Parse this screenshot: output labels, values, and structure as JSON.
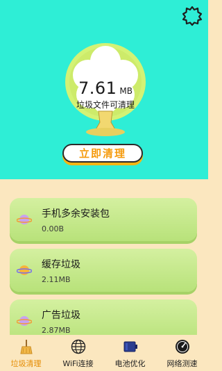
{
  "scan": {
    "size_value": "7.61",
    "size_unit": "MB",
    "label": "垃圾文件可清理",
    "button_label": "立即清理"
  },
  "items": [
    {
      "title": "手机多余安装包",
      "size": "0.00B",
      "icon": "planet-icon"
    },
    {
      "title": "缓存垃圾",
      "size": "2.11MB",
      "icon": "planet-icon"
    },
    {
      "title": "广告垃圾",
      "size": "2.87MB",
      "icon": "planet-icon"
    }
  ],
  "tabs": [
    {
      "label": "垃圾清理",
      "icon": "broom-icon",
      "active": true
    },
    {
      "label": "WiFi连接",
      "icon": "globe-icon",
      "active": false
    },
    {
      "label": "电池优化",
      "icon": "battery-icon",
      "active": false
    },
    {
      "label": "网络测速",
      "icon": "speedometer-icon",
      "active": false
    }
  ],
  "colors": {
    "header_bg": "#2eeed6",
    "page_bg": "#fbe7bf",
    "card_green": "#c3e88c",
    "button_text": "#f59a0c",
    "active_tab": "#e48b00"
  }
}
